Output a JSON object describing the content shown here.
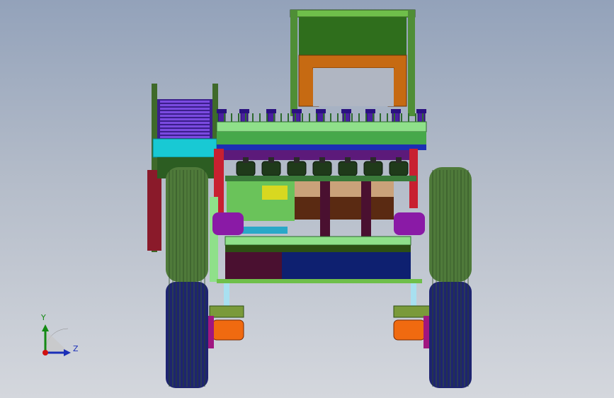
{
  "viewport": {
    "background_top": "#93a2ba",
    "background_bottom": "#d4d7dd"
  },
  "model": {
    "description_icon": "harvester-assembly-front-view",
    "colors": {
      "frame_dark_green": "#3f6a2a",
      "hopper_green": "#2f6e1c",
      "hopper_orange": "#c66a12",
      "tine_purple": "#4a1fa0",
      "blue": "#1c2fb4",
      "cyan": "#18c9d4",
      "magenta": "#a01680",
      "tire_green": "#4f7a3a",
      "tire_blue": "#1e2470",
      "orange_hub": "#f06a10",
      "maroon": "#4a1030",
      "navy_panel": "#0e2070",
      "light_green": "#8fe08a",
      "yellow": "#d8d820",
      "brown_panel": "#6a3a1a"
    }
  },
  "triad": {
    "y_label": "Y",
    "z_label": "Z",
    "y_color": "#148a14",
    "z_color": "#1b2fb8",
    "origin_color": "#d01010"
  }
}
